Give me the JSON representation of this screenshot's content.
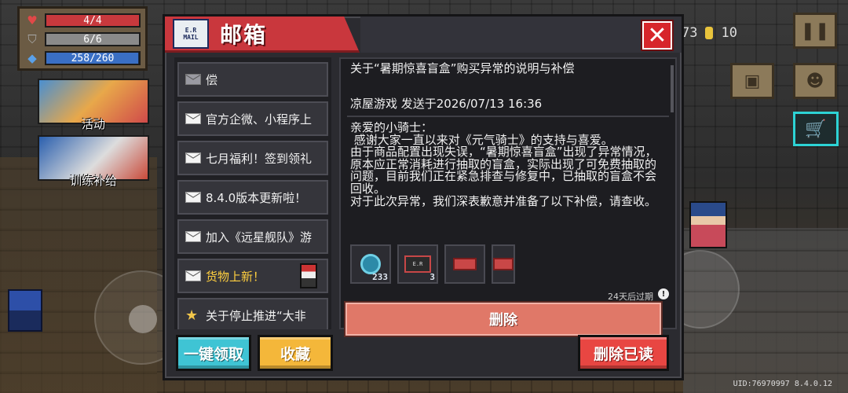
{
  "hud": {
    "hp": "4/4",
    "armor": "6/6",
    "energy": "258/260",
    "hp_fraction": 1.0,
    "armor_fraction": 1.0,
    "energy_fraction": 0.99,
    "gems": "73",
    "coins": "10",
    "uid": "UID:76970997 8.4.0.12"
  },
  "side_entries": {
    "activity": "活动",
    "training": "训练补给"
  },
  "mailbox": {
    "logo_line1": "E.R",
    "logo_line2": "MAIL",
    "title": "邮箱",
    "close_label": "✕",
    "items": [
      {
        "label": "偿",
        "icon": "envelope-open-icon"
      },
      {
        "label": "官方企微、小程序上",
        "icon": "envelope-icon"
      },
      {
        "label": "七月福利！签到领礼",
        "icon": "envelope-icon"
      },
      {
        "label": "8.4.0版本更新啦！",
        "icon": "envelope-icon"
      },
      {
        "label": "加入《远星舰队》游",
        "icon": "envelope-icon"
      },
      {
        "label": "货物上新！",
        "icon": "envelope-icon"
      },
      {
        "label": "关于停止推进“大非",
        "icon": "star-icon"
      }
    ],
    "detail": {
      "subject": "关于“暑期惊喜盲盒”购买异常的说明与补偿",
      "meta": "凉屋游戏 发送于2026/07/13 16:36",
      "body": "亲爱的小骑士：\n 感谢大家一直以来对《元气骑士》的支持与喜爱。\n由于商品配置出现失误，“暑期惊喜盲盒”出现了异常情况，原本应正常消耗进行抽取的盲盒，实际出现了可免费抽取的问题，目前我们正在紧急排查与修复中，已抽取的盲盒不会回收。\n对于此次异常，我们深表歉意并准备了以下补偿，请查收。",
      "attachments": [
        {
          "icon": "gem-icon",
          "qty": "233"
        },
        {
          "icon": "mail-card-icon",
          "qty": "3"
        },
        {
          "icon": "ticket-icon",
          "qty": ""
        },
        {
          "icon": "ticket-icon",
          "qty": ""
        }
      ],
      "expire": "24天后过期",
      "delete_label": "删除"
    },
    "buttons": {
      "claim_all": "一键领取",
      "favorite": "收藏",
      "delete_read": "删除已读"
    }
  },
  "colors": {
    "header_red": "#c9373d",
    "claim": "#3fc4d4",
    "favorite": "#f4b73a",
    "delete_read": "#e84642",
    "delete": "#e07868"
  }
}
